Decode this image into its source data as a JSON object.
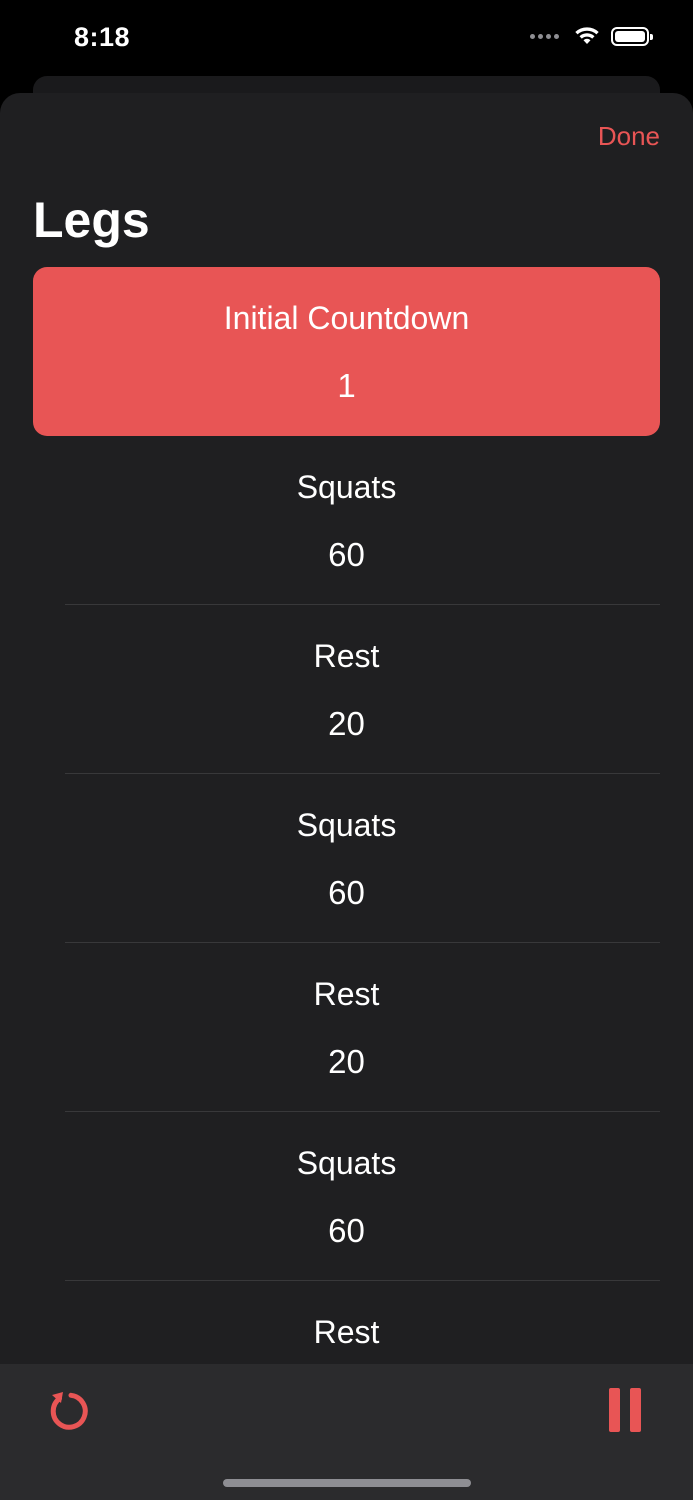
{
  "status_bar": {
    "time": "8:18",
    "icons": [
      "cellular-dots-icon",
      "wifi-icon",
      "battery-icon"
    ]
  },
  "header": {
    "done_label": "Done",
    "title": "Legs"
  },
  "accent_color": "#e85555",
  "intervals": [
    {
      "name": "Initial Countdown",
      "value": "1",
      "active": true
    },
    {
      "name": "Squats",
      "value": "60"
    },
    {
      "name": "Rest",
      "value": "20"
    },
    {
      "name": "Squats",
      "value": "60"
    },
    {
      "name": "Rest",
      "value": "20"
    },
    {
      "name": "Squats",
      "value": "60"
    },
    {
      "name": "Rest",
      "value": ""
    }
  ],
  "toolbar": {
    "left_icon": "reset-icon",
    "right_icon": "pause-icon"
  }
}
